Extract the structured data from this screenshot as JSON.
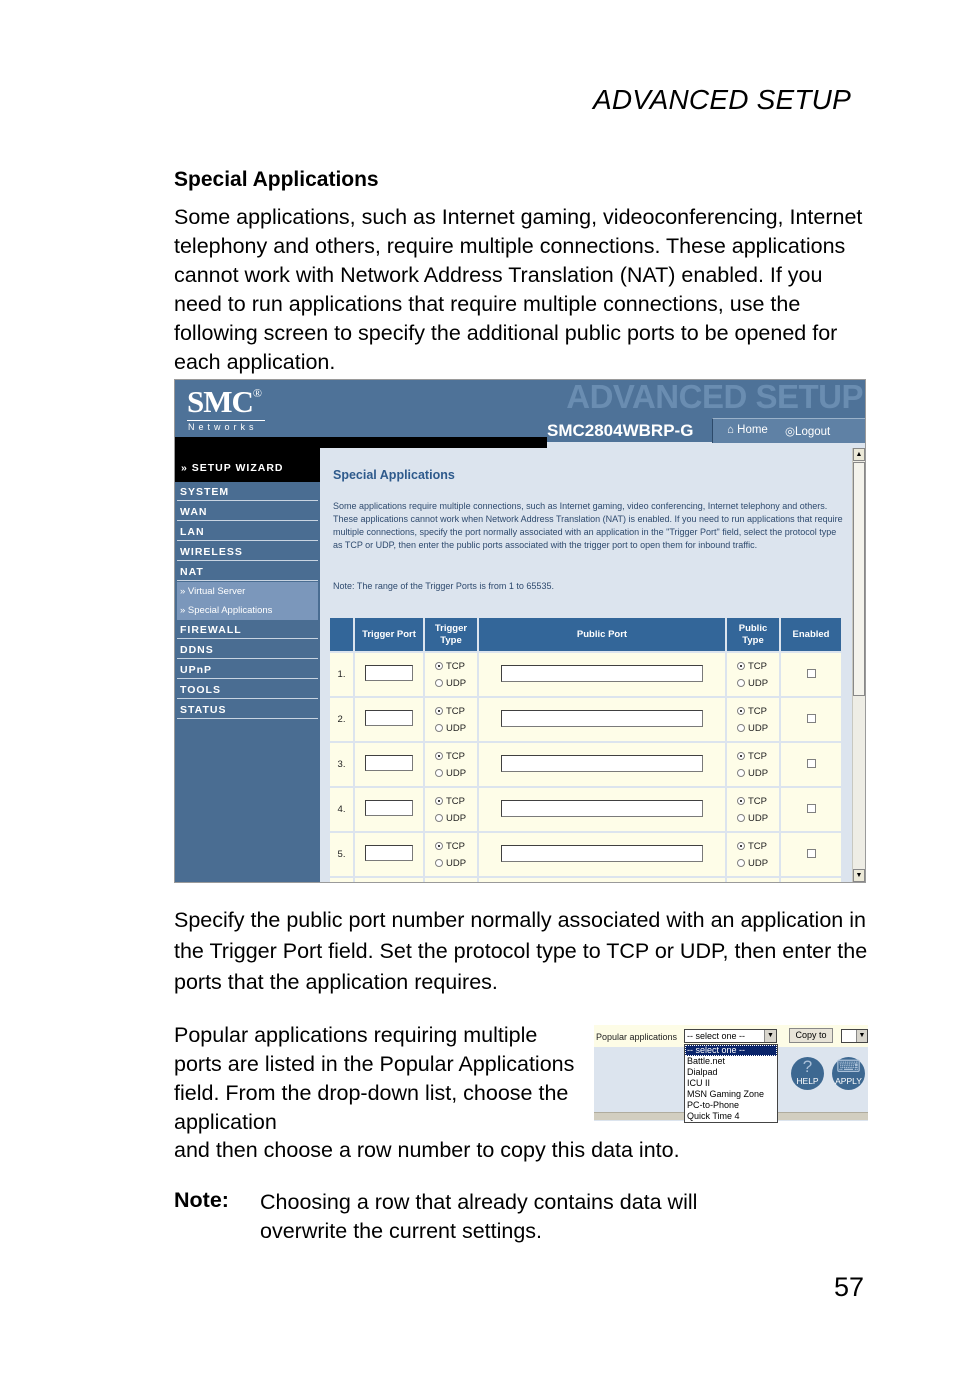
{
  "page": {
    "header": "ADVANCED SETUP",
    "section_title": "Special Applications",
    "intro": "Some applications, such as Internet gaming, videoconferencing, Internet telephony and others, require multiple connections. These applications cannot work with Network Address Translation (NAT) enabled. If you need to run applications that require multiple connections, use the following screen to specify the additional public ports to be opened for each application.",
    "after_screenshot": "Specify the public port number normally associated with an application in the Trigger Port field. Set the protocol type to TCP or UDP, then enter the ports that the application requires.",
    "popular_text": "Popular applications requiring multiple ports are listed in the Popular Applications field. From the drop-down list, choose the application",
    "popular_text_cont": "and then choose a row number to copy this data into.",
    "note_label": "Note:",
    "note_text": "Choosing a row that already contains data will overwrite the current settings.",
    "page_number": "57"
  },
  "router_ui": {
    "logo": "SMC",
    "logo_mark": "®",
    "logo_sub": "Networks",
    "banner": "ADVANCED SETUP",
    "model": "SMC2804WBRP-G",
    "nav": {
      "home": "Home",
      "logout": "Logout"
    },
    "sidebar": {
      "wizard": "» SETUP WIZARD",
      "items_top": [
        "SYSTEM",
        "WAN",
        "LAN",
        "WIRELESS",
        "NAT"
      ],
      "sub_items": [
        "» Virtual Server",
        "» Special Applications"
      ],
      "items_bottom": [
        "FIREWALL",
        "DDNS",
        "UPnP",
        "TOOLS",
        "STATUS"
      ]
    },
    "main": {
      "title": "Special Applications",
      "description": "Some applications require multiple connections, such as Internet gaming, video conferencing, Internet telephony and others. These applications cannot work when Network Address Translation (NAT) is enabled. If you need to run applications that require multiple connections, specify the port normally associated with an application in the \"Trigger Port\" field, select the protocol type as TCP or UDP, then enter the public ports associated with the trigger port to open them for inbound traffic.",
      "note": "Note: The range of the Trigger Ports is from 1 to 65535.",
      "table": {
        "headers": [
          "",
          "Trigger Port",
          "Trigger Type",
          "Public Port",
          "Public Type",
          "Enabled"
        ],
        "header_lines": {
          "trigger_type": [
            "Trigger",
            "Type"
          ],
          "public_type": [
            "Public",
            "Type"
          ]
        },
        "protocol_options": [
          "TCP",
          "UDP"
        ],
        "rows": [
          {
            "num": "1.",
            "trigger_port": "",
            "trigger_type": "TCP",
            "public_port": "",
            "public_type": "TCP",
            "enabled": false
          },
          {
            "num": "2.",
            "trigger_port": "",
            "trigger_type": "TCP",
            "public_port": "",
            "public_type": "TCP",
            "enabled": false
          },
          {
            "num": "3.",
            "trigger_port": "",
            "trigger_type": "TCP",
            "public_port": "",
            "public_type": "TCP",
            "enabled": false
          },
          {
            "num": "4.",
            "trigger_port": "",
            "trigger_type": "TCP",
            "public_port": "",
            "public_type": "TCP",
            "enabled": false
          },
          {
            "num": "5.",
            "trigger_port": "",
            "trigger_type": "TCP",
            "public_port": "",
            "public_type": "TCP",
            "enabled": false
          }
        ]
      }
    }
  },
  "popular_ui": {
    "label": "Popular applications",
    "selected": "-- select one --",
    "copy_button": "Copy to",
    "options": [
      "-- select one --",
      "Battle.net",
      "Dialpad",
      "ICU II",
      "MSN Gaming Zone",
      "PC-to-Phone",
      "Quick Time 4"
    ],
    "help_label": "HELP",
    "apply_label": "APPLY"
  }
}
